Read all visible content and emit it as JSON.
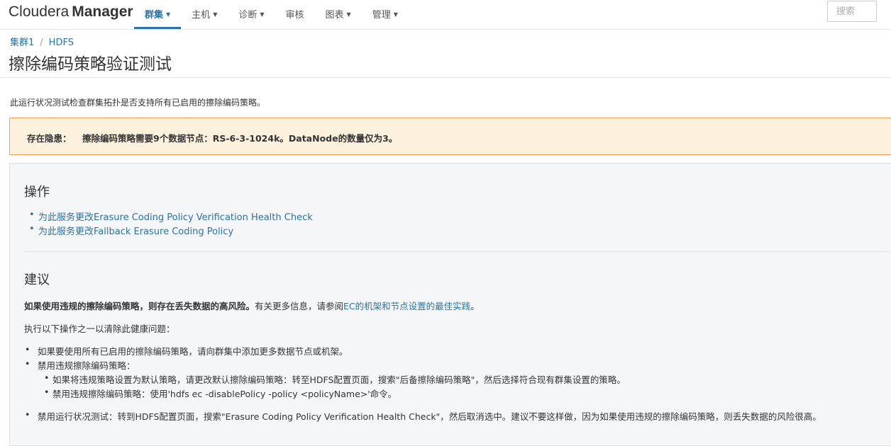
{
  "app": {
    "brand_light": "Cloudera",
    "brand_bold": "Manager"
  },
  "nav": {
    "items": [
      {
        "label": "群集",
        "caret": true,
        "active": true
      },
      {
        "label": "主机",
        "caret": true
      },
      {
        "label": "诊断",
        "caret": true
      },
      {
        "label": "审核",
        "caret": false
      },
      {
        "label": "图表",
        "caret": true
      },
      {
        "label": "管理",
        "caret": true
      }
    ],
    "search_placeholder": "搜索"
  },
  "breadcrumb": {
    "cluster": "集群1",
    "separator": "/",
    "service": "HDFS"
  },
  "page": {
    "title": "擦除编码策略验证测试",
    "description": "此运行状况测试检查群集拓扑是否支持所有已启用的擦除编码策略。"
  },
  "alert": {
    "label": "存在隐患：",
    "message": "擦除编码策略需要9个数据节点：RS-6-3-1024k。DataNode的数量仅为3。"
  },
  "actions": {
    "title": "操作",
    "links": [
      "为此服务更改Erasure Coding Policy Verification Health Check",
      "为此服务更改Fallback Erasure Coding Policy"
    ]
  },
  "advice": {
    "title": "建议",
    "risk_bold": "如果使用违规的擦除编码策略，则存在丢失数据的高风险。",
    "more_info": "有关更多信息，请参阅",
    "more_info_link": "EC的机架和节点设置的最佳实践",
    "more_info_end": "。",
    "intro": "执行以下操作之一以清除此健康问题：",
    "option1": "如果要使用所有已启用的擦除编码策略，请向群集中添加更多数据节点或机架。",
    "option2": "禁用违规擦除编码策略：",
    "option2_sub1": "如果将违规策略设置为默认策略，请更改默认擦除编码策略：转至HDFS配置页面，搜索\"后备擦除编码策略\"，然后选择符合现有群集设置的策略。",
    "option2_sub2": "禁用违规擦除编码策略：使用'hdfs ec -disablePolicy -policy <policyName>'命令。",
    "option3": "禁用运行状况测试：转到HDFS配置页面，搜索\"Erasure Coding Policy Verification Health Check\"，然后取消选中。建议不要这样做，因为如果使用违规的擦除编码策略，则丢失数据的风险很高。"
  },
  "colors": {
    "accent": "#2a72a8",
    "alert_bg": "#fcf1dc",
    "alert_border": "#f0a050",
    "panel_bg": "#f5f6f8"
  }
}
